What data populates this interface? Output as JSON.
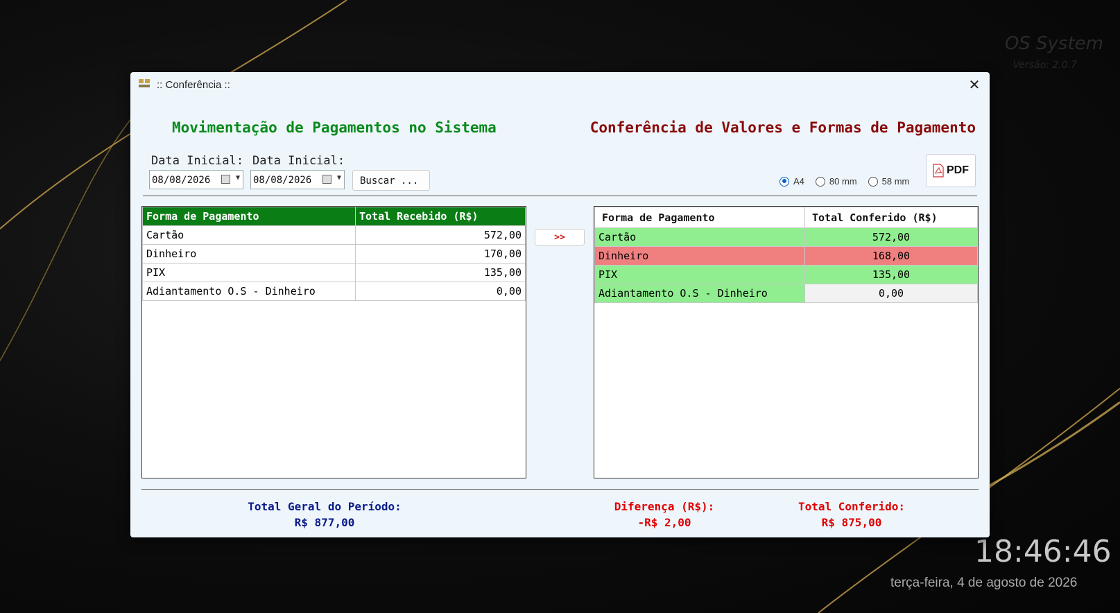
{
  "desktop": {
    "brand_name": "OS System",
    "brand_version": "Versão: 2.0.7",
    "clock": "18:46:46",
    "date": "terça-feira, 4 de agosto de 2026"
  },
  "window": {
    "title": ":: Conferência ::",
    "close_glyph": "✕"
  },
  "left": {
    "heading": "Movimentação de Pagamentos no Sistema",
    "date_label_1": "Data Inicial:",
    "date_label_2": "Data Inicial:",
    "date_value_1": "08/08/2026",
    "date_value_2": "08/08/2026",
    "search_button": "Buscar ...",
    "columns": [
      "Forma de Pagamento",
      "Total Recebido (R$)"
    ],
    "rows": [
      {
        "forma": "Cartão",
        "total": "572,00"
      },
      {
        "forma": "Dinheiro",
        "total": "170,00"
      },
      {
        "forma": "PIX",
        "total": "135,00"
      },
      {
        "forma": "Adiantamento O.S - Dinheiro",
        "total": "0,00"
      }
    ]
  },
  "right": {
    "heading": "Conferência de Valores e Formas de Pagamento",
    "print_options": [
      "A4",
      "80 mm",
      "58 mm"
    ],
    "print_selected": "A4",
    "pdf_button": "PDF",
    "columns": [
      "Forma de Pagamento",
      "Total Conferido (R$)"
    ],
    "rows": [
      {
        "forma": "Cartão",
        "total": "572,00",
        "status": "green"
      },
      {
        "forma": "Dinheiro",
        "total": "168,00",
        "status": "red"
      },
      {
        "forma": "PIX",
        "total": "135,00",
        "status": "green"
      },
      {
        "forma": "Adiantamento O.S - Dinheiro",
        "total": "0,00",
        "status": "green"
      }
    ]
  },
  "transfer_button": ">>",
  "totals": {
    "geral_label": "Total Geral do Período:",
    "geral_value": "R$ 877,00",
    "diferenca_label": "Diferença (R$):",
    "diferenca_value": "-R$ 2,00",
    "conferido_label": "Total Conferido:",
    "conferido_value": "R$ 875,00"
  },
  "colors": {
    "green_heading": "#0a8a1c",
    "red_heading": "#8a0a0a",
    "ok_row": "#90ee90",
    "diff_row": "#f08080",
    "total_blue": "#0a1a8a",
    "total_red": "#e00000"
  }
}
